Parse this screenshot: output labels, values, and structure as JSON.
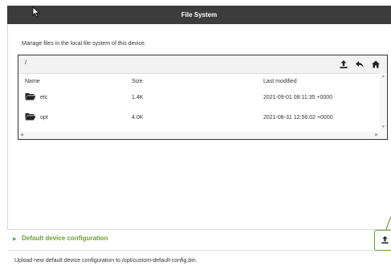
{
  "window": {
    "title": "File System"
  },
  "intro": {
    "text": "Manage files in the local file system of this device."
  },
  "browser": {
    "path": "/",
    "toolbar": {
      "upload_icon": "upload-icon",
      "back_icon": "back-arrow-icon",
      "home_icon": "home-icon"
    },
    "columns": {
      "name": "Name",
      "size": "Size",
      "modified": "Last modified"
    },
    "rows": [
      {
        "name": "etc",
        "size": "1.4K",
        "modified": "2021-09-01 08:11:35 +0000"
      },
      {
        "name": "opt",
        "size": "4.0K",
        "modified": "2021-08-31 12:56:02 +0000"
      }
    ]
  },
  "default_config": {
    "label": "Default device configuration",
    "note": "Upload new default device configuration to /opt/custom-default-config.bin."
  },
  "colors": {
    "accent": "#6a9f34",
    "titlebar": "#3c3c3c",
    "pathbar": "#f2f2f2"
  }
}
